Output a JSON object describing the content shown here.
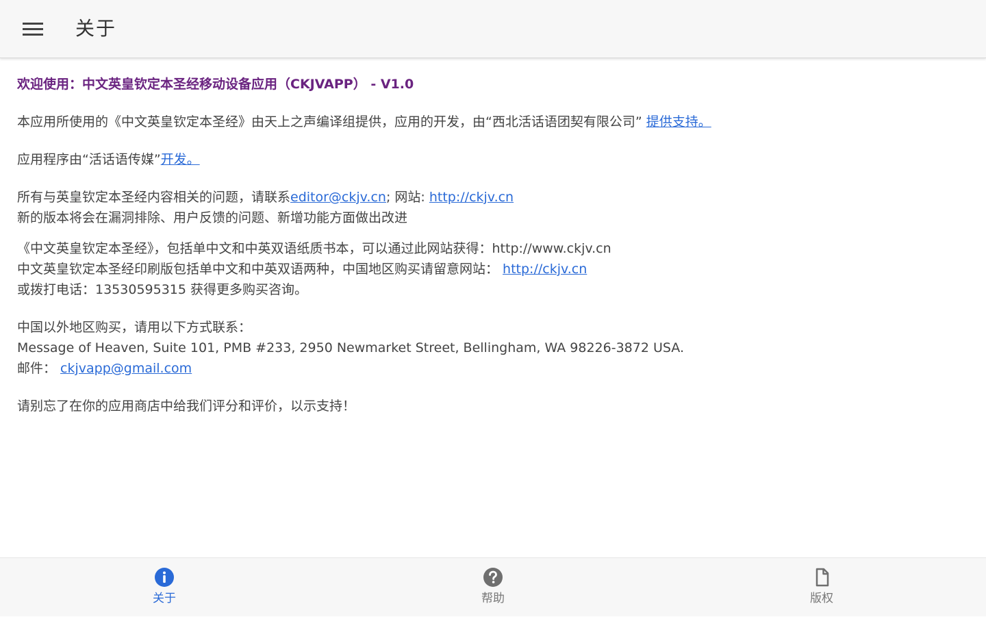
{
  "appbar": {
    "title": "关于",
    "menu_icon": "hamburger-menu-icon"
  },
  "content": {
    "welcome": "欢迎使用：中文英皇钦定本圣经移动设备应用（CKJVAPP） - V1.0",
    "para1_text": "本应用所使用的《中文英皇钦定本圣经》由天上之声编译组提供，应用的开发，由“西北活话语团契有限公司” ",
    "para1_link": "提供支持。",
    "para2_text": "应用程序由“活话语传媒”",
    "para2_link": "开发。",
    "para3_text1": "所有与英皇钦定本圣经内容相关的问题，请联系",
    "para3_email": "editor@ckjv.cn",
    "para3_text2": "; 网站: ",
    "para3_site": "http://ckjv.cn",
    "para3_line2": "新的版本将会在漏洞排除、用户反馈的问题、新增功能方面做出改进",
    "para4_line1": "《中文英皇钦定本圣经》，包括单中文和中英双语纸质书本，可以通过此网站获得：http://www.ckjv.cn",
    "para4_line2_text": "中文英皇钦定本圣经印刷版包括单中文和中英双语两种，中国地区购买请留意网站： ",
    "para4_line2_link": "http://ckjv.cn",
    "para4_line3": "或拨打电话：13530595315 获得更多购买咨询。",
    "para5_line1": "中国以外地区购买，请用以下方式联系：",
    "para5_line2": "Message of Heaven, Suite 101, PMB #233, 2950 Newmarket Street, Bellingham, WA 98226-3872 USA.",
    "para5_mail_label": "邮件： ",
    "para5_mail_link": "ckjvapp@gmail.com",
    "para6": "请别忘了在你的应用商店中给我们评分和评价，以示支持！"
  },
  "bottom_nav": {
    "tabs": [
      {
        "label": "关于",
        "icon": "info-icon",
        "active": true
      },
      {
        "label": "帮助",
        "icon": "help-icon",
        "active": false
      },
      {
        "label": "版权",
        "icon": "document-icon",
        "active": false
      }
    ]
  },
  "colors": {
    "accent": "#2a6ad7",
    "welcome_title": "#6a2380",
    "appbar_bg": "#f7f7f7",
    "inactive_icon": "#6f6f6f"
  }
}
